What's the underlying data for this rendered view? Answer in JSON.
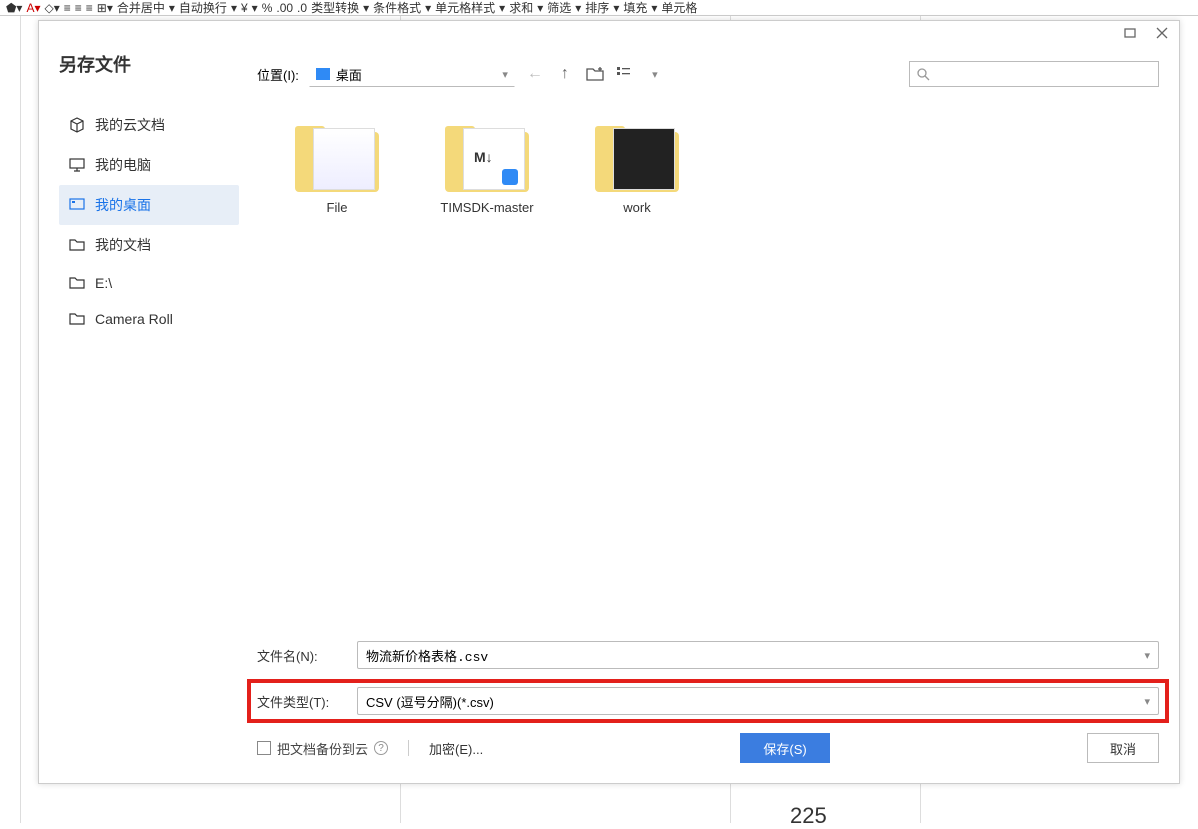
{
  "toolbar": {
    "items": [
      "合并居中",
      "自动换行",
      "¥",
      "%",
      "类型转换",
      "条件格式",
      "单元格样式",
      "求和",
      "筛选",
      "排序",
      "填充",
      "单元格"
    ]
  },
  "sheet": {
    "val1": "225"
  },
  "dialog": {
    "title": "另存文件",
    "loc_label": "位置(I):",
    "loc_value": "桌面",
    "search_placeholder": "",
    "sidebar": [
      {
        "label": "我的云文档",
        "icon": "cube"
      },
      {
        "label": "我的电脑",
        "icon": "monitor"
      },
      {
        "label": "我的桌面",
        "icon": "desktop",
        "active": true
      },
      {
        "label": "我的文档",
        "icon": "folder"
      },
      {
        "label": "E:\\",
        "icon": "folder"
      },
      {
        "label": "Camera Roll",
        "icon": "folder"
      }
    ],
    "files": [
      {
        "name": "File"
      },
      {
        "name": "TIMSDK-master"
      },
      {
        "name": "work"
      }
    ],
    "filename_label": "文件名(N):",
    "filename_value": "物流新价格表格.csv",
    "filetype_label": "文件类型(T):",
    "filetype_value": "CSV (逗号分隔)(*.csv)",
    "backup_label": "把文档备份到云",
    "encrypt_label": "加密(E)...",
    "save_btn": "保存(S)",
    "cancel_btn": "取消"
  }
}
